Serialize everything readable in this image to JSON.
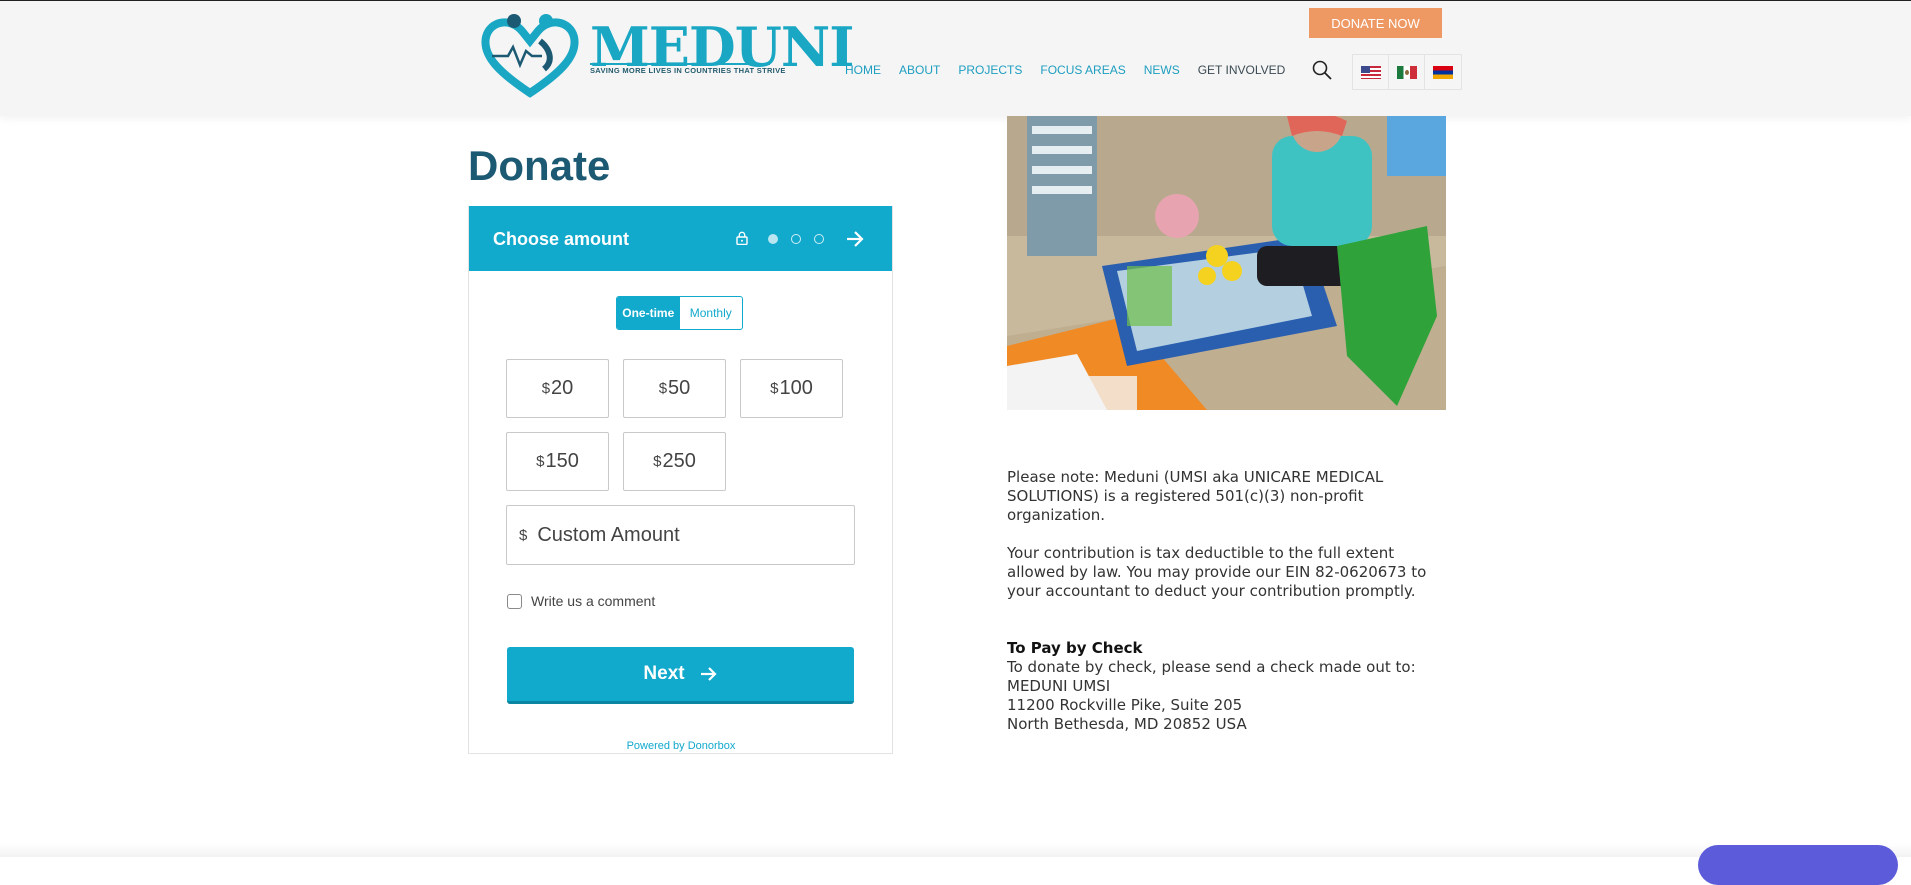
{
  "header": {
    "logo_text": "MEDUNI",
    "logo_tagline": "SAVING MORE LIVES IN COUNTRIES THAT STRIVE",
    "donate_button": "DONATE NOW",
    "nav": [
      "HOME",
      "ABOUT",
      "PROJECTS",
      "FOCUS AREAS",
      "NEWS",
      "GET INVOLVED"
    ],
    "flags": [
      "us-flag-icon",
      "mexico-flag-icon",
      "armenia-flag-icon"
    ]
  },
  "page": {
    "title": "Donate"
  },
  "widget": {
    "step_title": "Choose amount",
    "frequency": {
      "one_time": "One-time",
      "monthly": "Monthly",
      "selected": "One-time"
    },
    "currency": "$",
    "amounts": [
      "20",
      "50",
      "100",
      "150",
      "250"
    ],
    "custom_placeholder": "Custom Amount",
    "comment_label": "Write us a comment",
    "next_label": "Next",
    "powered_by": "Powered by Donorbox",
    "steps_total": 3,
    "current_step": 1
  },
  "info": {
    "note": "Please note: Meduni (UMSI aka UNICARE MEDICAL SOLUTIONS) is a registered 501(c)(3) non-profit organization.",
    "tax": "Your contribution is tax deductible to the full extent allowed by law. You may provide our EIN 82-0620673 to your accountant to deduct your contribution promptly.",
    "check_heading": "To Pay by Check",
    "check_intro": "To donate by check, please send a check made out to:",
    "address": [
      "MEDUNI UMSI",
      "11200 Rockville Pike, Suite 205",
      "North Bethesda, MD 20852 USA"
    ]
  },
  "colors": {
    "accent": "#11a9cc",
    "title": "#1c5a73",
    "donate_now": "#ee9964"
  }
}
